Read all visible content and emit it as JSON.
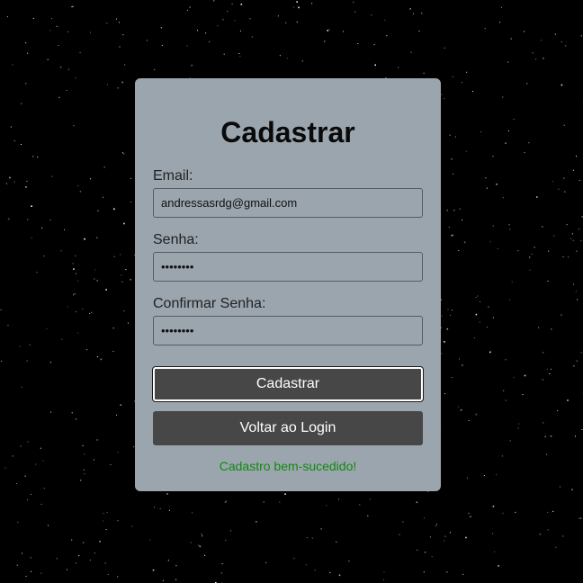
{
  "background": {
    "color": "#000000",
    "star_color": "#ffffff"
  },
  "card": {
    "background": "#9ba5ae"
  },
  "form": {
    "title": "Cadastrar",
    "email": {
      "label": "Email:",
      "value": "andressasrdg@gmail.com"
    },
    "password": {
      "label": "Senha:",
      "value": "••••••••"
    },
    "confirm_password": {
      "label": "Confirmar Senha:",
      "value": "••••••••"
    },
    "submit_label": "Cadastrar",
    "back_label": "Voltar ao Login",
    "status_message": "Cadastro bem-sucedido!",
    "status_color": "#108a10",
    "button_color": "#474747"
  }
}
